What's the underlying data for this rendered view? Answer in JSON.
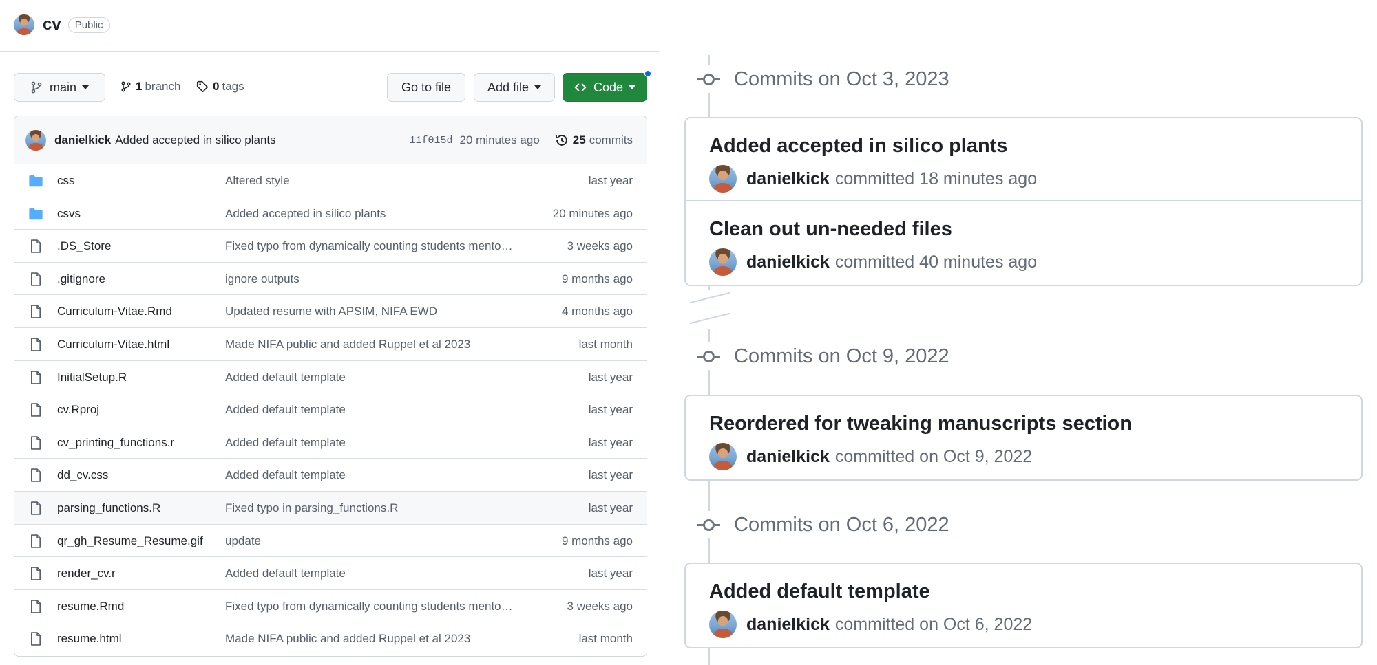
{
  "repo": {
    "name": "cv",
    "visibility": "Public"
  },
  "toolbar": {
    "branch": "main",
    "branch_count": "1",
    "branch_label": "branch",
    "tag_count": "0",
    "tag_label": "tags",
    "goto_file": "Go to file",
    "add_file": "Add file",
    "code": "Code"
  },
  "latest_commit": {
    "author": "danielkick",
    "message": "Added accepted in silico plants",
    "sha": "11f015d",
    "time": "20 minutes ago",
    "count": "25",
    "count_label": "commits"
  },
  "files": [
    {
      "type": "dir",
      "name": "css",
      "message": "Altered style",
      "age": "last year"
    },
    {
      "type": "dir",
      "name": "csvs",
      "message": "Added accepted in silico plants",
      "age": "20 minutes ago"
    },
    {
      "type": "file",
      "name": ".DS_Store",
      "message": "Fixed typo from dynamically counting students mento…",
      "age": "3 weeks ago"
    },
    {
      "type": "file",
      "name": ".gitignore",
      "message": "ignore outputs",
      "age": "9 months ago"
    },
    {
      "type": "file",
      "name": "Curriculum-Vitae.Rmd",
      "message": "Updated resume with APSIM, NIFA EWD",
      "age": "4 months ago"
    },
    {
      "type": "file",
      "name": "Curriculum-Vitae.html",
      "message": "Made NIFA public and added Ruppel et al 2023",
      "age": "last month"
    },
    {
      "type": "file",
      "name": "InitialSetup.R",
      "message": "Added default template",
      "age": "last year"
    },
    {
      "type": "file",
      "name": "cv.Rproj",
      "message": "Added default template",
      "age": "last year"
    },
    {
      "type": "file",
      "name": "cv_printing_functions.r",
      "message": "Added default template",
      "age": "last year"
    },
    {
      "type": "file",
      "name": "dd_cv.css",
      "message": "Added default template",
      "age": "last year"
    },
    {
      "type": "file",
      "name": "parsing_functions.R",
      "message": "Fixed typo in parsing_functions.R",
      "age": "last year"
    },
    {
      "type": "file",
      "name": "qr_gh_Resume_Resume.gif",
      "message": "update",
      "age": "9 months ago"
    },
    {
      "type": "file",
      "name": "render_cv.r",
      "message": "Added default template",
      "age": "last year"
    },
    {
      "type": "file",
      "name": "resume.Rmd",
      "message": "Fixed typo from dynamically counting students mento…",
      "age": "3 weeks ago"
    },
    {
      "type": "file",
      "name": "resume.html",
      "message": "Made NIFA public and added Ruppel et al 2023",
      "age": "last month"
    }
  ],
  "timeline": [
    {
      "heading": "Commits on Oct 3, 2023",
      "commits": [
        {
          "title": "Added accepted in silico plants",
          "author": "danielkick",
          "when": "committed 18 minutes ago"
        },
        {
          "title": "Clean out un-needed files",
          "author": "danielkick",
          "when": "committed 40 minutes ago"
        }
      ]
    },
    {
      "heading": "Commits on Oct 9, 2022",
      "commits": [
        {
          "title": "Reordered for tweaking manuscripts section",
          "author": "danielkick",
          "when": "committed on Oct 9, 2022"
        }
      ]
    },
    {
      "heading": "Commits on Oct 6, 2022",
      "commits": [
        {
          "title": "Added default template",
          "author": "danielkick",
          "when": "committed on Oct 6, 2022"
        }
      ]
    }
  ],
  "icons": {
    "folder": "folder-icon",
    "file": "file-icon",
    "branch": "git-branch-icon",
    "tag": "tag-icon",
    "history": "history-icon",
    "code": "code-icon",
    "commit": "git-commit-icon"
  },
  "colors": {
    "code_button": "#1f883d",
    "folder": "#54aeff",
    "link_dot": "#0969da"
  }
}
